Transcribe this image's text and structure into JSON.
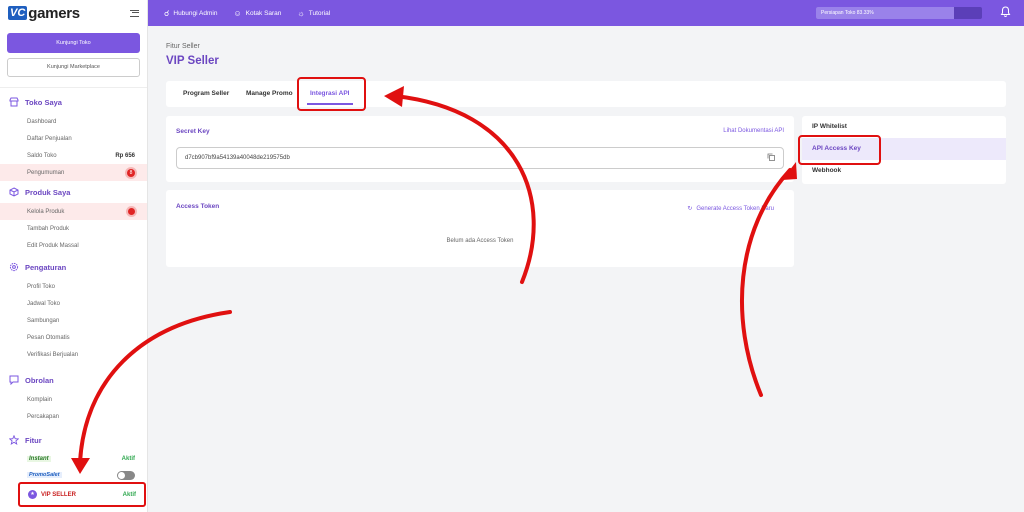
{
  "logo": {
    "mark": "VC",
    "text": "gamers"
  },
  "sidebar": {
    "visit_store": "Kunjungi Toko",
    "visit_marketplace": "Kunjungi Marketplace",
    "toko_saya": {
      "title": "Toko Saya",
      "items": [
        "Dashboard",
        "Daftar Penjualan",
        "Saldo Toko",
        "Pengumuman"
      ],
      "saldo_value": "Rp 656",
      "pengumuman_badge": "8"
    },
    "produk_saya": {
      "title": "Produk Saya",
      "items": [
        "Kelola Produk",
        "Tambah Produk",
        "Edit Produk Massal"
      ]
    },
    "pengaturan": {
      "title": "Pengaturan",
      "items": [
        "Profil Toko",
        "Jadwal Toko",
        "Sambungan",
        "Pesan Otomatis",
        "Verifikasi Berjualan"
      ]
    },
    "obrolan": {
      "title": "Obrolan",
      "items": [
        "Komplain",
        "Percakapan"
      ]
    },
    "fitur": {
      "title": "Fitur",
      "instant_label": "Instant",
      "instant_status": "Aktif",
      "promo_label": "PromoSalet",
      "vip_label": "VIP SELLER",
      "vip_status": "Aktif"
    }
  },
  "topbar": {
    "nav": [
      "Hubungi Admin",
      "Kotak Saran",
      "Tutorial"
    ],
    "progress_text": "Persiapan Toko 83.33%",
    "progress_value": 0.8333
  },
  "page": {
    "breadcrumb": "Fitur Seller",
    "title": "VIP Seller",
    "tabs": [
      "Program Seller",
      "Manage Promo",
      "Integrasi API"
    ],
    "active_tab": "Integrasi API"
  },
  "secret_key": {
    "label": "Secret Key",
    "doc_link": "Lihat Dokumentasi API",
    "value": "d7cb907bf9a54139a40048de219575db"
  },
  "access_token": {
    "label": "Access Token",
    "generate": "Generate Access Token Baru",
    "empty": "Belum ada Access Token"
  },
  "api_menu": {
    "items": [
      "IP Whitelist",
      "API Access Key",
      "Webhook"
    ],
    "active": "API Access Key"
  },
  "colors": {
    "primary": "#7b57e0",
    "annotation": "#e01010",
    "active_text": "#6b46c1"
  }
}
